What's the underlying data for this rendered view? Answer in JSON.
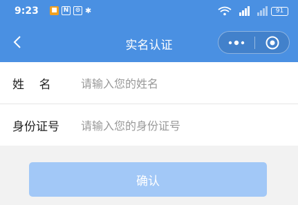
{
  "status_bar": {
    "time": "9:23",
    "left_icons": [
      "notification-app-icon",
      "nfc-icon",
      "alarm-icon",
      "bluetooth-icon"
    ],
    "right_icons": [
      "wifi-icon",
      "signal-4g-icon",
      "signal-icon"
    ],
    "battery": "91"
  },
  "nav": {
    "title": "实名认证",
    "back_icon": "chevron-left-icon",
    "capsule": {
      "more_icon": "more-dots-icon",
      "close_icon": "target-circle-icon"
    }
  },
  "form": {
    "name_label": "姓    名",
    "name_placeholder": "请输入您的姓名",
    "id_label": "身份证号",
    "id_placeholder": "请输入您的身份证号"
  },
  "submit": {
    "label": "确认"
  },
  "colors": {
    "header": "#4a90e2",
    "button": "#a2c8f7",
    "page_bg": "#f2f2f2"
  }
}
